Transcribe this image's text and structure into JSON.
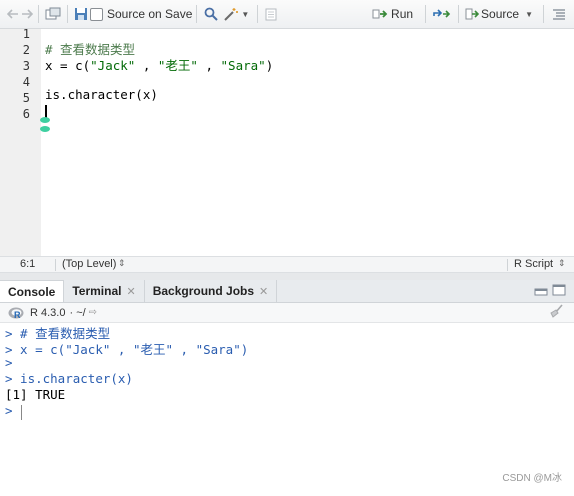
{
  "toolbar": {
    "source_on_save_label": "Source on Save",
    "run_label": "Run",
    "source_label": "Source"
  },
  "editor": {
    "line_numbers": [
      "1",
      "2",
      "3",
      "4",
      "5",
      "6"
    ],
    "lines": [
      "",
      "# 查看数据类型",
      "x = c(\"Jack\" , \"老王\" , \"Sara\")",
      "",
      "is.character(x)",
      ""
    ]
  },
  "statusbar": {
    "position": "6:1",
    "scope": "(Top Level)",
    "file_type": "R Script"
  },
  "console_tabs": [
    {
      "label": "Console"
    },
    {
      "label": "Terminal"
    },
    {
      "label": "Background Jobs"
    }
  ],
  "console_header": {
    "r_version": "R 4.3.0",
    "working_dir": "· ~/"
  },
  "console": {
    "prompt": ">",
    "lines": [
      {
        "prompt": ">",
        "text": " # 查看数据类型"
      },
      {
        "prompt": ">",
        "text": " x = c(\"Jack\" , \"老王\" , \"Sara\")"
      },
      {
        "prompt": ">",
        "text": ""
      },
      {
        "prompt": ">",
        "text": " is.character(x)"
      },
      {
        "prompt": "",
        "text": "[1] TRUE"
      },
      {
        "prompt": ">",
        "text": ""
      }
    ]
  },
  "watermark": "CSDN @M冰",
  "colors": {
    "comment": "#4d7b4d",
    "string": "#036a07",
    "prompt": "#2a5db0",
    "run_arrow": "#3a8a3a",
    "accent": "#3ecfa0"
  }
}
